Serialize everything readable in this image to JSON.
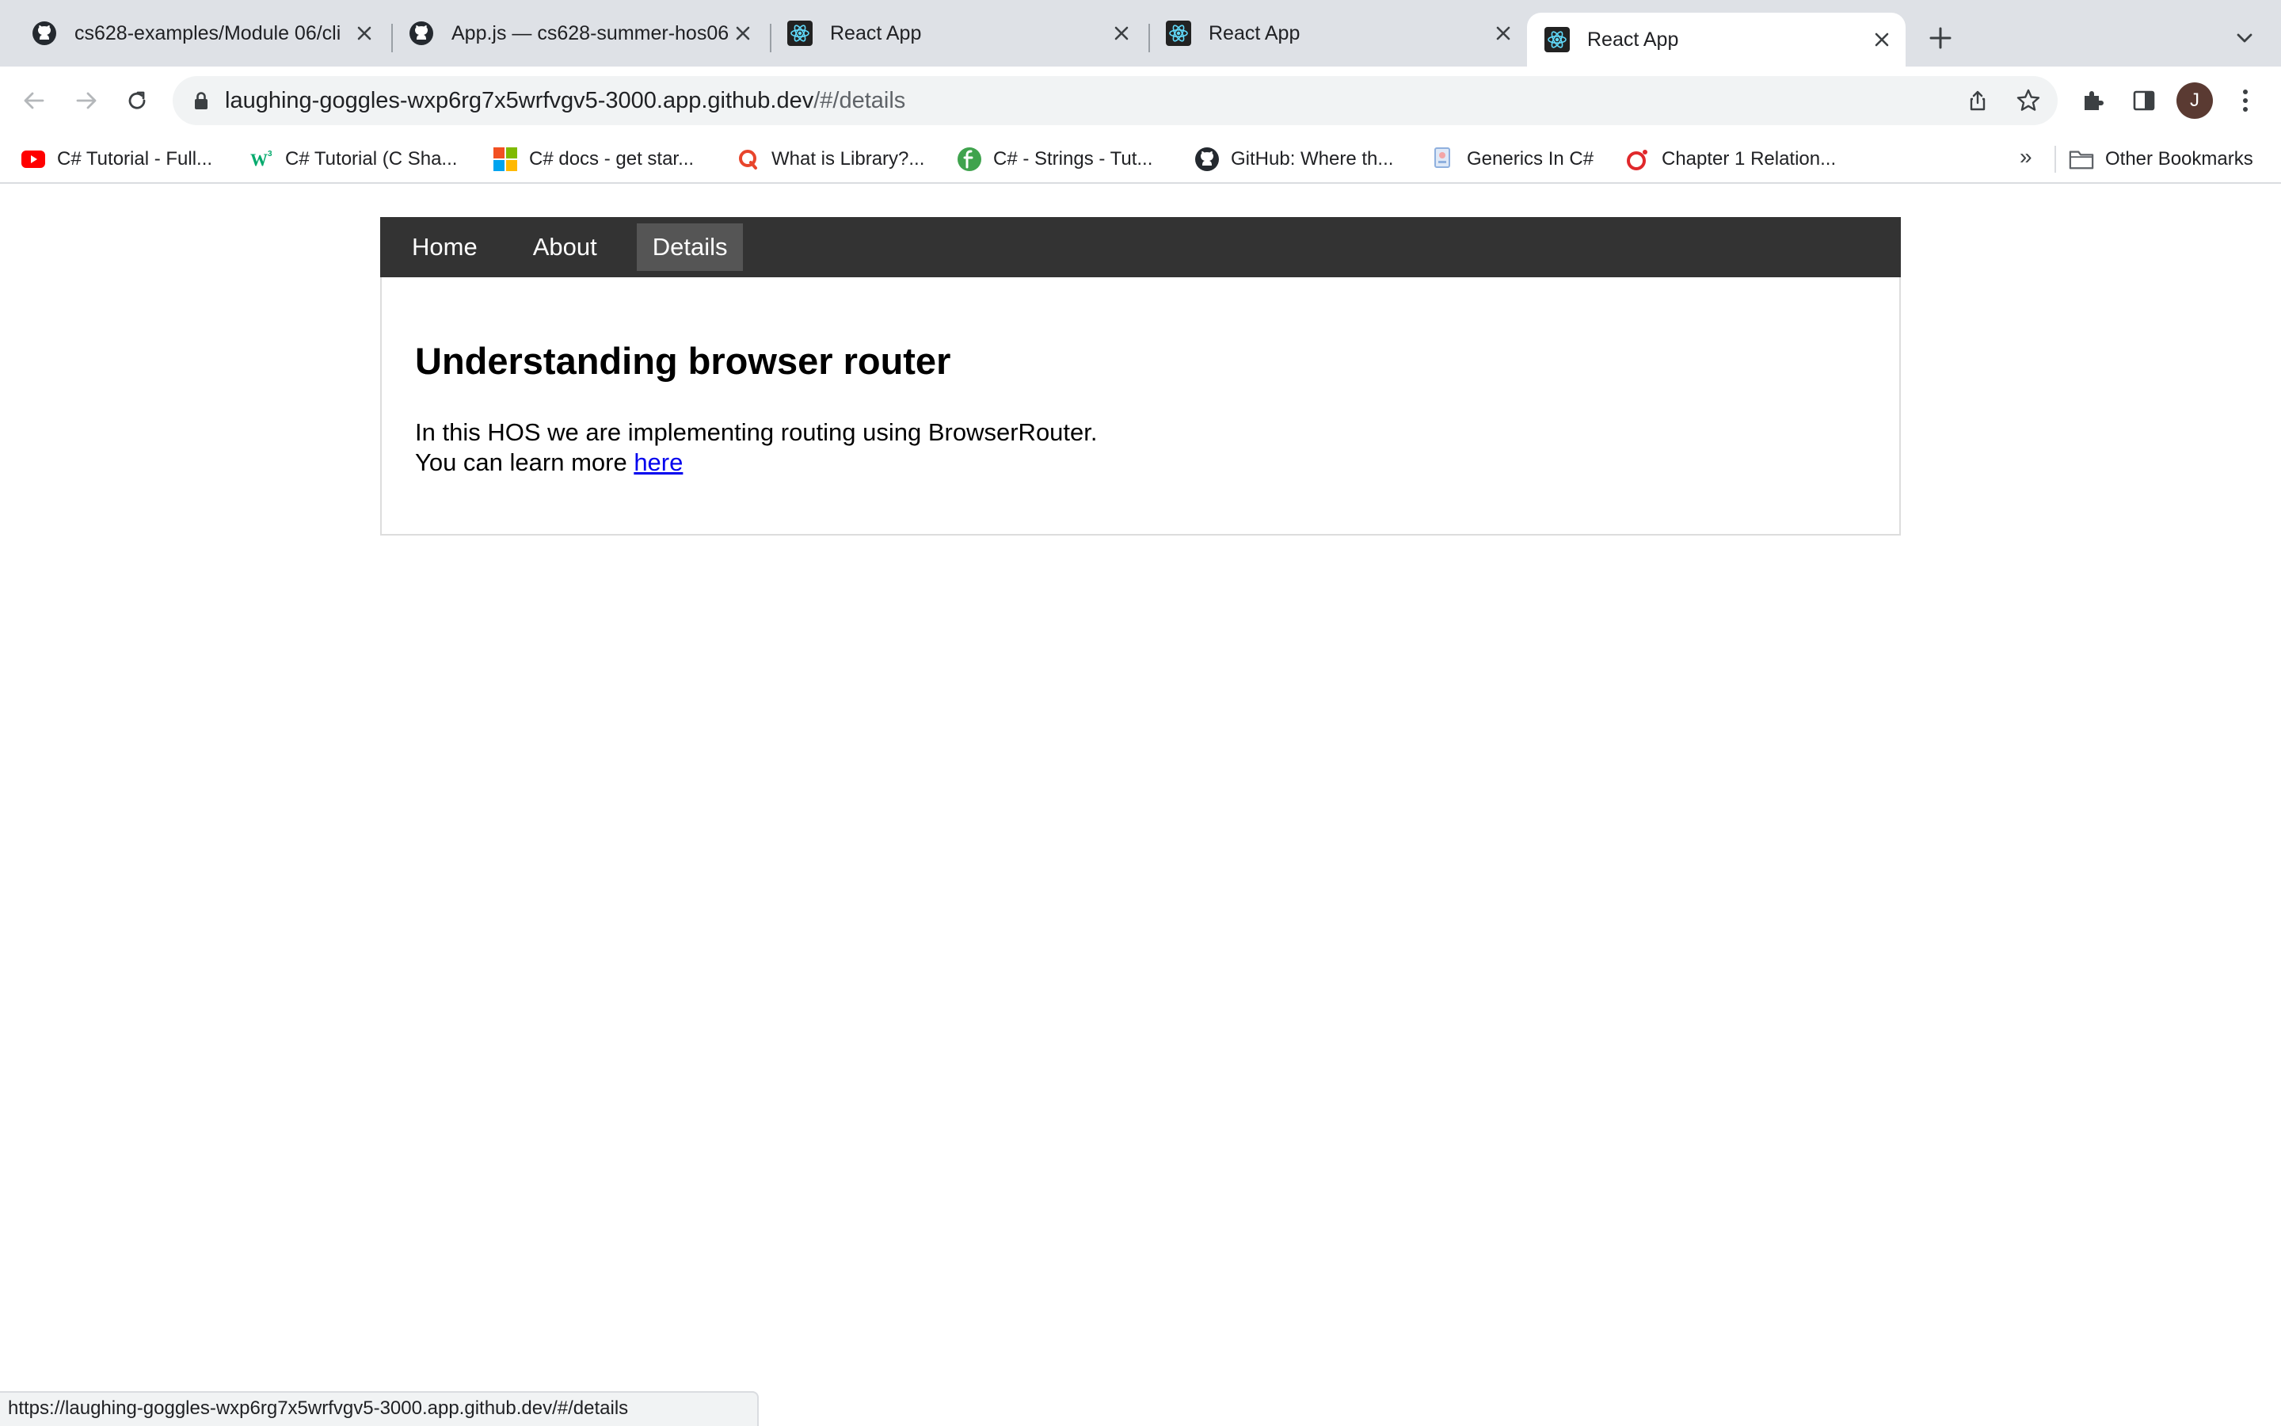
{
  "browser": {
    "tabs": [
      {
        "title": "cs628-examples/Module 06/cli",
        "icon": "github-icon",
        "active": false
      },
      {
        "title": "App.js — cs628-summer-hos06",
        "icon": "github-icon",
        "active": false
      },
      {
        "title": "React App",
        "icon": "react-icon",
        "active": false
      },
      {
        "title": "React App",
        "icon": "react-icon",
        "active": false
      },
      {
        "title": "React App",
        "icon": "react-icon",
        "active": true
      }
    ],
    "address": {
      "host": "laughing-goggles-wxp6rg7x5wrfvgv5-3000.app.github.dev",
      "path": "/#/details"
    },
    "profile_initial": "J",
    "bookmarks": [
      {
        "label": "C# Tutorial - Full...",
        "icon": "youtube-icon"
      },
      {
        "label": "C# Tutorial (C Sha...",
        "icon": "w3schools-icon"
      },
      {
        "label": "C# docs - get star...",
        "icon": "microsoft-icon"
      },
      {
        "label": "What is Library?...",
        "icon": "search-bookmark-icon"
      },
      {
        "label": "C# - Strings - Tut...",
        "icon": "tutorials-icon"
      },
      {
        "label": "GitHub: Where th...",
        "icon": "github-icon"
      },
      {
        "label": "Generics In C#",
        "icon": "bookmark-page-icon"
      },
      {
        "label": "Chapter 1 Relation...",
        "icon": "opera-icon"
      }
    ],
    "bookmarks_overflow": "»",
    "other_bookmarks": "Other Bookmarks",
    "status_url": "https://laughing-goggles-wxp6rg7x5wrfvgv5-3000.app.github.dev/#/details"
  },
  "app": {
    "nav": [
      {
        "label": "Home",
        "active": false
      },
      {
        "label": "About",
        "active": false
      },
      {
        "label": "Details",
        "active": true
      }
    ],
    "heading": "Understanding browser router",
    "paragraph_line1": "In this HOS we are implementing routing using BrowserRouter.",
    "paragraph_line2_prefix": "You can learn more ",
    "link_text": "here"
  },
  "colors": {
    "tab_strip": "#dee1e6",
    "app_nav_bg": "#333333",
    "app_nav_active": "#555555",
    "link": "#0000ee"
  }
}
